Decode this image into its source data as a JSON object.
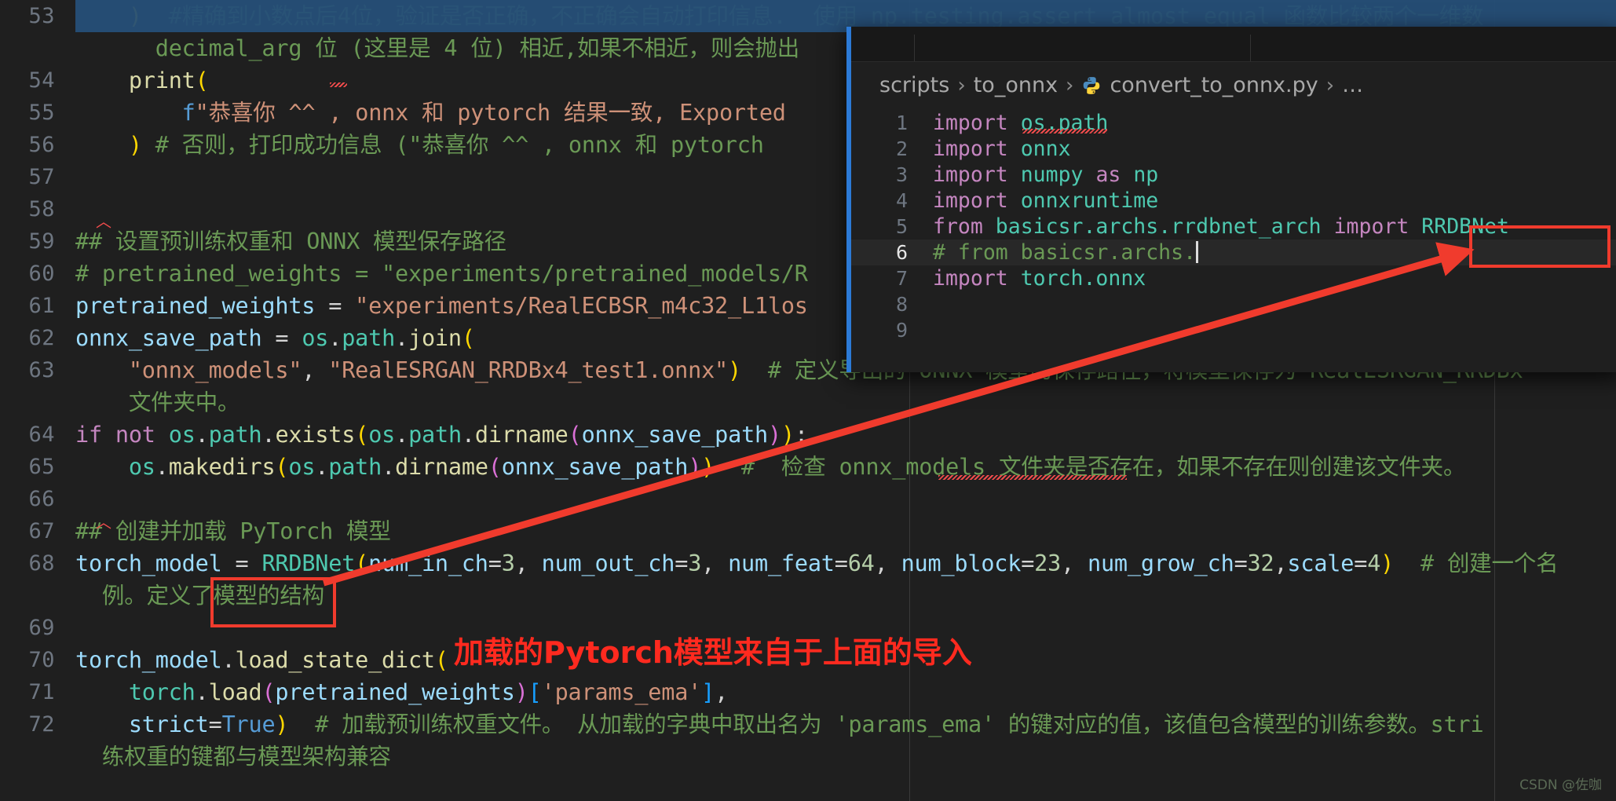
{
  "app": {
    "name": "vscode-editor",
    "theme_background": "#1f1f1f",
    "accent_blue": "#2c7ad6",
    "annotation_red": "#f03b2d",
    "selection_blue": "#264f78"
  },
  "editor": {
    "name": "convert_to_onnx-main-editor",
    "lines": [
      {
        "number": "53",
        "segments": [
          {
            "text": "    ",
            "cls": "ws"
          },
          {
            "text": ")",
            "cls": "par1"
          },
          {
            "text": "  #精确到小数点后4位，验证是否正确，不正确会自动打印信息.  使用 ",
            "cls": "cmt"
          },
          {
            "text": "np.testing.assert_almost_equal",
            "cls": "cmt"
          },
          {
            "text": " 函数比较两个一维数",
            "cls": "cmt"
          }
        ]
      },
      {
        "number": "",
        "wrap": true,
        "segments": [
          {
            "text": "      ",
            "cls": "ws"
          },
          {
            "text": "decimal_arg",
            "cls": "cmt"
          },
          {
            "text": " 位 (这里是 4 位) 相近,如果不相近，则会抛出",
            "cls": "cmt"
          }
        ]
      },
      {
        "number": "54",
        "segments": [
          {
            "text": "    ",
            "cls": "ws"
          },
          {
            "text": "print",
            "cls": "fn"
          },
          {
            "text": "(",
            "cls": "par1"
          }
        ]
      },
      {
        "number": "55",
        "segments": [
          {
            "text": "        ",
            "cls": "ws"
          },
          {
            "text": "f",
            "cls": "kw2"
          },
          {
            "text": "\"恭喜你 ^^ , onnx 和 pytorch 结果一致, Exported",
            "cls": "str"
          }
        ]
      },
      {
        "number": "56",
        "segments": [
          {
            "text": "    ",
            "cls": "ws"
          },
          {
            "text": ")",
            "cls": "par1"
          },
          {
            "text": " # 否则，打印成功信息 (\"恭喜你 ^^ , onnx 和 pytorch",
            "cls": "cmt"
          }
        ]
      },
      {
        "number": "57",
        "segments": []
      },
      {
        "number": "58",
        "segments": []
      },
      {
        "number": "59",
        "segments": [
          {
            "text": "## ",
            "cls": "cmt"
          },
          {
            "text": "设置预训练权重和 ONNX 模型保存路径",
            "cls": "cmt"
          }
        ]
      },
      {
        "number": "60",
        "segments": [
          {
            "text": "# pretrained_weights = \"experiments/pretrained_models/R",
            "cls": "cmt"
          }
        ]
      },
      {
        "number": "61",
        "segments": [
          {
            "text": "pretrained_weights",
            "cls": "var"
          },
          {
            "text": " = ",
            "cls": "op"
          },
          {
            "text": "\"experiments/RealECBSR_m4c32_L1los",
            "cls": "str"
          }
        ]
      },
      {
        "number": "62",
        "segments": [
          {
            "text": "onnx_save_path",
            "cls": "var"
          },
          {
            "text": " = ",
            "cls": "op"
          },
          {
            "text": "os",
            "cls": "cls"
          },
          {
            "text": ".",
            "cls": "op"
          },
          {
            "text": "path",
            "cls": "cls"
          },
          {
            "text": ".",
            "cls": "op"
          },
          {
            "text": "join",
            "cls": "fn"
          },
          {
            "text": "(",
            "cls": "par1"
          }
        ]
      },
      {
        "number": "63",
        "segments": [
          {
            "text": "    ",
            "cls": "ws"
          },
          {
            "text": "\"onnx_models\"",
            "cls": "str"
          },
          {
            "text": ", ",
            "cls": "op"
          },
          {
            "text": "\"RealESRGAN_RRDBx4_test1.onnx\"",
            "cls": "str"
          },
          {
            "text": ")",
            "cls": "par1"
          },
          {
            "text": "  # 定义导出的 ONNX 模型的保存路径，将模型保存为 RealESRGAN_RRDBx",
            "cls": "cmt"
          }
        ]
      },
      {
        "number": "",
        "wrap": true,
        "segments": [
          {
            "text": "    ",
            "cls": "ws"
          },
          {
            "text": "文件夹中。",
            "cls": "cmt"
          }
        ]
      },
      {
        "number": "64",
        "segments": [
          {
            "text": "if",
            "cls": "kw"
          },
          {
            "text": " ",
            "cls": "op"
          },
          {
            "text": "not",
            "cls": "kw"
          },
          {
            "text": " ",
            "cls": "op"
          },
          {
            "text": "os",
            "cls": "cls"
          },
          {
            "text": ".",
            "cls": "op"
          },
          {
            "text": "path",
            "cls": "cls"
          },
          {
            "text": ".",
            "cls": "op"
          },
          {
            "text": "exists",
            "cls": "fn"
          },
          {
            "text": "(",
            "cls": "par1"
          },
          {
            "text": "os",
            "cls": "cls"
          },
          {
            "text": ".",
            "cls": "op"
          },
          {
            "text": "path",
            "cls": "cls"
          },
          {
            "text": ".",
            "cls": "op"
          },
          {
            "text": "dirname",
            "cls": "fn"
          },
          {
            "text": "(",
            "cls": "par2"
          },
          {
            "text": "onnx_save_path",
            "cls": "var"
          },
          {
            "text": ")",
            "cls": "par2"
          },
          {
            "text": ")",
            "cls": "par1"
          },
          {
            "text": ":",
            "cls": "op"
          }
        ]
      },
      {
        "number": "65",
        "segments": [
          {
            "text": "    ",
            "cls": "ws"
          },
          {
            "text": "os",
            "cls": "cls"
          },
          {
            "text": ".",
            "cls": "op"
          },
          {
            "text": "makedirs",
            "cls": "fn"
          },
          {
            "text": "(",
            "cls": "par1"
          },
          {
            "text": "os",
            "cls": "cls"
          },
          {
            "text": ".",
            "cls": "op"
          },
          {
            "text": "path",
            "cls": "cls"
          },
          {
            "text": ".",
            "cls": "op"
          },
          {
            "text": "dirname",
            "cls": "fn"
          },
          {
            "text": "(",
            "cls": "par2"
          },
          {
            "text": "onnx_save_path",
            "cls": "var"
          },
          {
            "text": ")",
            "cls": "par2"
          },
          {
            "text": ")",
            "cls": "par1"
          },
          {
            "text": "  #  检查 onnx_models 文件夹是否存在，如果不存在则创建该文件夹。",
            "cls": "cmt"
          }
        ]
      },
      {
        "number": "66",
        "segments": []
      },
      {
        "number": "67",
        "segments": [
          {
            "text": "## ",
            "cls": "cmt"
          },
          {
            "text": "创建并加载 PyTorch 模型",
            "cls": "cmt"
          }
        ]
      },
      {
        "number": "68",
        "segments": [
          {
            "text": "torch_model",
            "cls": "var"
          },
          {
            "text": " = ",
            "cls": "op"
          },
          {
            "text": "RRDBNet",
            "cls": "cls"
          },
          {
            "text": "(",
            "cls": "par1"
          },
          {
            "text": "num_in_ch",
            "cls": "var"
          },
          {
            "text": "=",
            "cls": "op"
          },
          {
            "text": "3",
            "cls": "num"
          },
          {
            "text": ", ",
            "cls": "op"
          },
          {
            "text": "num_out_ch",
            "cls": "var"
          },
          {
            "text": "=",
            "cls": "op"
          },
          {
            "text": "3",
            "cls": "num"
          },
          {
            "text": ", ",
            "cls": "op"
          },
          {
            "text": "num_feat",
            "cls": "var"
          },
          {
            "text": "=",
            "cls": "op"
          },
          {
            "text": "64",
            "cls": "num"
          },
          {
            "text": ", ",
            "cls": "op"
          },
          {
            "text": "num_block",
            "cls": "var"
          },
          {
            "text": "=",
            "cls": "op"
          },
          {
            "text": "23",
            "cls": "num"
          },
          {
            "text": ", ",
            "cls": "op"
          },
          {
            "text": "num_grow_ch",
            "cls": "var"
          },
          {
            "text": "=",
            "cls": "op"
          },
          {
            "text": "32",
            "cls": "num"
          },
          {
            "text": ",",
            "cls": "op"
          },
          {
            "text": "scale",
            "cls": "var"
          },
          {
            "text": "=",
            "cls": "op"
          },
          {
            "text": "4",
            "cls": "num"
          },
          {
            "text": ")",
            "cls": "par1"
          },
          {
            "text": "  # 创建一个名",
            "cls": "cmt"
          }
        ]
      },
      {
        "number": "",
        "wrap": true,
        "segments": [
          {
            "text": "  ",
            "cls": "ws"
          },
          {
            "text": "例。定义了模型的结构",
            "cls": "cmt"
          }
        ]
      },
      {
        "number": "69",
        "segments": []
      },
      {
        "number": "70",
        "segments": [
          {
            "text": "torch_model",
            "cls": "var"
          },
          {
            "text": ".",
            "cls": "op"
          },
          {
            "text": "load_state_dict",
            "cls": "fn"
          },
          {
            "text": "(",
            "cls": "par1"
          }
        ]
      },
      {
        "number": "71",
        "segments": [
          {
            "text": "    ",
            "cls": "ws"
          },
          {
            "text": "torch",
            "cls": "cls"
          },
          {
            "text": ".",
            "cls": "op"
          },
          {
            "text": "load",
            "cls": "fn"
          },
          {
            "text": "(",
            "cls": "par2"
          },
          {
            "text": "pretrained_weights",
            "cls": "var"
          },
          {
            "text": ")",
            "cls": "par2"
          },
          {
            "text": "[",
            "cls": "par3"
          },
          {
            "text": "'params_ema'",
            "cls": "str"
          },
          {
            "text": "]",
            "cls": "par3"
          },
          {
            "text": ",",
            "cls": "op"
          }
        ]
      },
      {
        "number": "72",
        "segments": [
          {
            "text": "    ",
            "cls": "ws"
          },
          {
            "text": "strict",
            "cls": "var"
          },
          {
            "text": "=",
            "cls": "op"
          },
          {
            "text": "True",
            "cls": "kw2"
          },
          {
            "text": ")",
            "cls": "par1"
          },
          {
            "text": "  # 加载预训练权重文件。 从加载的字典中取出名为 'params_ema' 的键对应的值，该值包含模型的训练参数。stri",
            "cls": "cmt"
          }
        ]
      },
      {
        "number": "",
        "wrap": true,
        "segments": [
          {
            "text": "  ",
            "cls": "ws"
          },
          {
            "text": "练权重的键都与模型架构兼容",
            "cls": "cmt"
          }
        ]
      }
    ]
  },
  "peek_window": {
    "name": "definition-peek-popup",
    "breadcrumb": {
      "folder": "scripts",
      "subfolder": "to_onnx",
      "file": "convert_to_onnx.py",
      "file_icon": "python-icon",
      "ellipsis": "…",
      "separator": "›"
    },
    "lines": [
      {
        "number": "1",
        "active": false,
        "segments": [
          {
            "text": "import",
            "cls": "kw"
          },
          {
            "text": " ",
            "cls": "op"
          },
          {
            "text": "os.path",
            "cls": "cls"
          }
        ]
      },
      {
        "number": "2",
        "active": false,
        "segments": [
          {
            "text": "import",
            "cls": "kw"
          },
          {
            "text": " ",
            "cls": "op"
          },
          {
            "text": "onnx",
            "cls": "cls"
          }
        ]
      },
      {
        "number": "3",
        "active": false,
        "segments": [
          {
            "text": "import",
            "cls": "kw"
          },
          {
            "text": " ",
            "cls": "op"
          },
          {
            "text": "numpy",
            "cls": "cls"
          },
          {
            "text": " ",
            "cls": "op"
          },
          {
            "text": "as",
            "cls": "kw"
          },
          {
            "text": " ",
            "cls": "op"
          },
          {
            "text": "np",
            "cls": "cls"
          }
        ]
      },
      {
        "number": "4",
        "active": false,
        "segments": [
          {
            "text": "import",
            "cls": "kw"
          },
          {
            "text": " ",
            "cls": "op"
          },
          {
            "text": "onnxruntime",
            "cls": "cls"
          }
        ]
      },
      {
        "number": "5",
        "active": false,
        "segments": [
          {
            "text": "from",
            "cls": "kw"
          },
          {
            "text": " ",
            "cls": "op"
          },
          {
            "text": "basicsr.archs.rrdbnet_arch",
            "cls": "cls"
          },
          {
            "text": " ",
            "cls": "op"
          },
          {
            "text": "import",
            "cls": "kw"
          },
          {
            "text": " ",
            "cls": "op"
          },
          {
            "text": "RRDBNet",
            "cls": "cls"
          }
        ]
      },
      {
        "number": "6",
        "active": true,
        "cursor": true,
        "segments": [
          {
            "text": "# from basicsr.archs.",
            "cls": "cmt"
          }
        ]
      },
      {
        "number": "7",
        "active": false,
        "segments": [
          {
            "text": "import",
            "cls": "kw"
          },
          {
            "text": " ",
            "cls": "op"
          },
          {
            "text": "torch.onnx",
            "cls": "cls"
          }
        ]
      },
      {
        "number": "8",
        "active": false,
        "segments": []
      },
      {
        "number": "9",
        "active": false,
        "segments": []
      }
    ]
  },
  "annotations": {
    "note_text": "加载的Pytorch模型来自于上面的导入",
    "highlight_boxes": [
      {
        "name": "rrdbnet-import-highlight",
        "label": "RRDBNet"
      },
      {
        "name": "rrdbnet-usage-highlight",
        "label": "RRDBNet"
      }
    ],
    "arrow": {
      "name": "red-arrow",
      "from": "torch_model RRDBNet usage",
      "to": "import RRDBNet"
    }
  },
  "watermark": {
    "text": "CSDN @佐咖"
  }
}
